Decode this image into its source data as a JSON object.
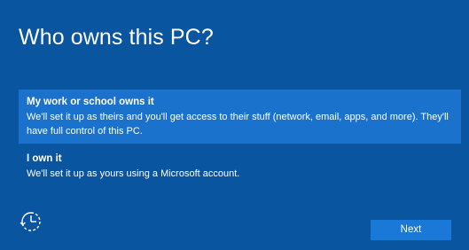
{
  "page": {
    "title": "Who owns this PC?"
  },
  "options": [
    {
      "title": "My work or school owns it",
      "description": "We'll set it up as theirs and you'll get access to their stuff (network, email, apps, and more). They'll have full control of this PC.",
      "selected": true
    },
    {
      "title": "I own it",
      "description": "We'll set it up as yours using a Microsoft account.",
      "selected": false
    }
  ],
  "footer": {
    "ease_of_access_icon": "ease-of-access-icon",
    "next_label": "Next"
  },
  "colors": {
    "background": "#0a55a0",
    "selected_option": "#1a72cc",
    "button": "#1a78d6",
    "text": "#ffffff"
  }
}
